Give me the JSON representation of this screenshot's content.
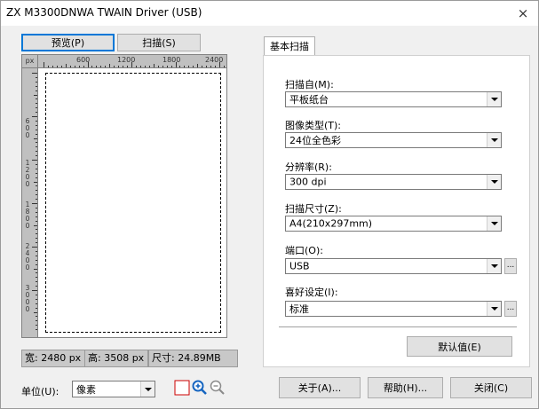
{
  "window": {
    "title": "ZX M3300DNWA TWAIN Driver (USB)",
    "close_glyph": "×"
  },
  "preview": {
    "preview_button": "预览(P)",
    "scan_button": "扫描(S)",
    "ruler_unit": "px",
    "ruler_h_labels": [
      "600",
      "1200",
      "1800",
      "2400"
    ],
    "ruler_v_labels": [
      "600",
      "1200",
      "1800",
      "2400",
      "3000"
    ]
  },
  "info": {
    "width": "宽: 2480 px",
    "height": "高: 3508 px",
    "size": "尺寸: 24.89MB"
  },
  "unit": {
    "label": "单位(U):",
    "value": "像素"
  },
  "tab": {
    "label": "基本扫描"
  },
  "fields": {
    "scan_from_label": "扫描自(M):",
    "scan_from_value": "平板纸台",
    "image_type_label": "图像类型(T):",
    "image_type_value": "24位全色彩",
    "resolution_label": "分辨率(R):",
    "resolution_value": "300 dpi",
    "scan_size_label": "扫描尺寸(Z):",
    "scan_size_value": "A4(210x297mm)",
    "port_label": "端口(O):",
    "port_value": "USB",
    "preference_label": "喜好设定(I):",
    "preference_value": "标准"
  },
  "buttons": {
    "default": "默认值(E)",
    "about": "关于(A)...",
    "help": "帮助(H)...",
    "close": "关闭(C)",
    "ellipsis": "..."
  },
  "colors": {
    "focus_border": "#0078d7",
    "zoom_in": "#1565c0",
    "select_tool_border": "#cc0000"
  }
}
